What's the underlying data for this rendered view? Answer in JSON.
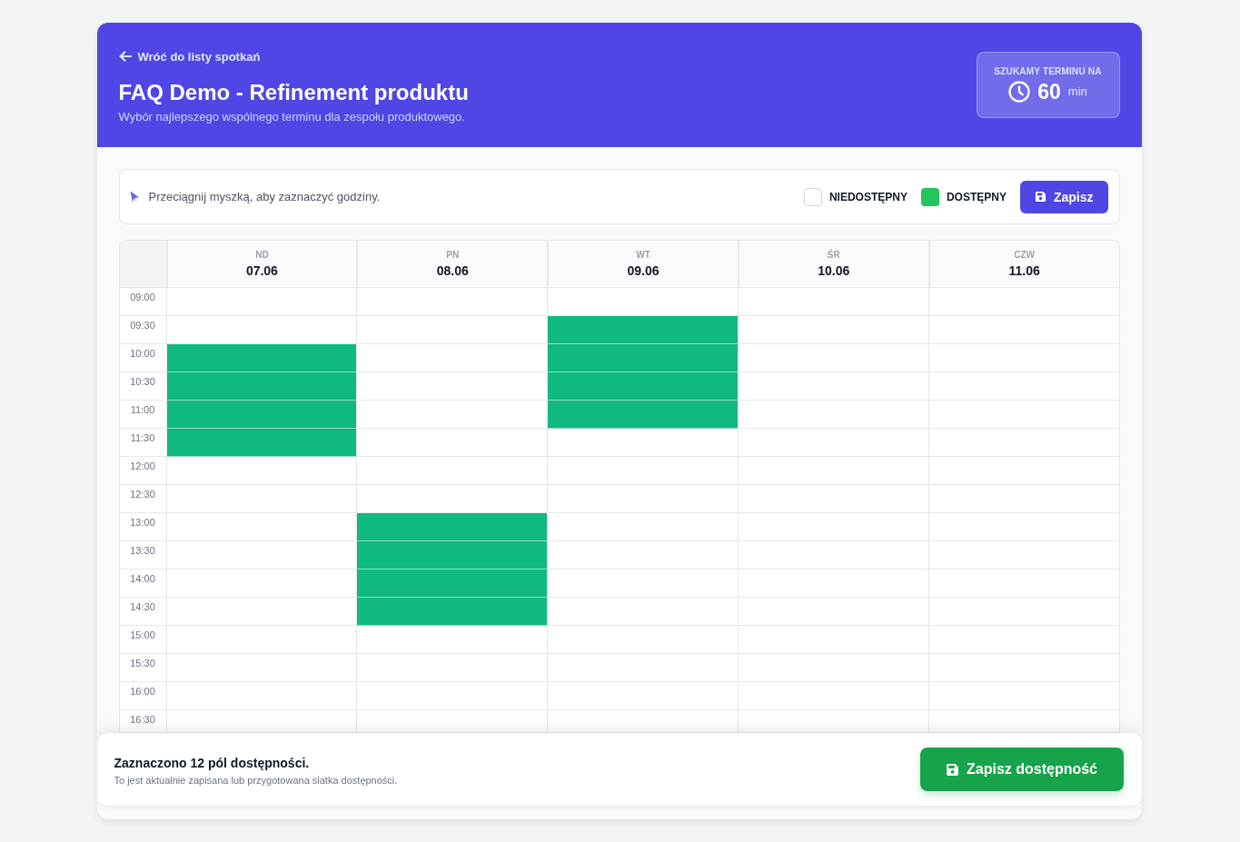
{
  "header": {
    "back_link": "Wróć do listy spotkań",
    "title": "FAQ Demo - Refinement produktu",
    "subtitle": "Wybór najlepszego wspólnego terminu dla zespołu produktowego.",
    "duration": {
      "label": "SZUKAMY TERMINU NA",
      "value": "60",
      "unit": "min"
    }
  },
  "toolbar": {
    "hint": "Przeciągnij myszką, aby zaznaczyć godziny.",
    "legend": [
      {
        "label": "NIEDOSTĘPNY",
        "color": "#ffffff"
      },
      {
        "label": "DOSTĘPNY",
        "color": "#22c55e"
      }
    ],
    "save_button": "Zapisz"
  },
  "grid": {
    "days": [
      {
        "weekday": "ND",
        "date": "07.06"
      },
      {
        "weekday": "PN",
        "date": "08.06"
      },
      {
        "weekday": "WT",
        "date": "09.06"
      },
      {
        "weekday": "ŚR",
        "date": "10.06"
      },
      {
        "weekday": "CZW",
        "date": "11.06"
      }
    ],
    "rows": [
      {
        "time": "09:00",
        "cells": [
          {
            "available": false
          },
          {
            "available": false
          },
          {
            "available": false
          },
          {
            "available": false
          },
          {
            "available": false
          }
        ]
      },
      {
        "time": "09:30",
        "cells": [
          {
            "available": false
          },
          {
            "available": false
          },
          {
            "available": true
          },
          {
            "available": false
          },
          {
            "available": false
          }
        ]
      },
      {
        "time": "10:00",
        "cells": [
          {
            "available": true
          },
          {
            "available": false
          },
          {
            "available": true
          },
          {
            "available": false
          },
          {
            "available": false
          }
        ]
      },
      {
        "time": "10:30",
        "cells": [
          {
            "available": true
          },
          {
            "available": false
          },
          {
            "available": true
          },
          {
            "available": false
          },
          {
            "available": false
          }
        ]
      },
      {
        "time": "11:00",
        "cells": [
          {
            "available": true
          },
          {
            "available": false
          },
          {
            "available": true
          },
          {
            "available": false
          },
          {
            "available": false
          }
        ]
      },
      {
        "time": "11:30",
        "cells": [
          {
            "available": true
          },
          {
            "available": false
          },
          {
            "available": false
          },
          {
            "available": false
          },
          {
            "available": false
          }
        ]
      },
      {
        "time": "12:00",
        "cells": [
          {
            "available": false
          },
          {
            "available": false
          },
          {
            "available": false
          },
          {
            "available": false
          },
          {
            "available": false
          }
        ]
      },
      {
        "time": "12:30",
        "cells": [
          {
            "available": false
          },
          {
            "available": false
          },
          {
            "available": false
          },
          {
            "available": false
          },
          {
            "available": false
          }
        ]
      },
      {
        "time": "13:00",
        "cells": [
          {
            "available": false
          },
          {
            "available": true
          },
          {
            "available": false
          },
          {
            "available": false
          },
          {
            "available": false
          }
        ]
      },
      {
        "time": "13:30",
        "cells": [
          {
            "available": false
          },
          {
            "available": true
          },
          {
            "available": false
          },
          {
            "available": false
          },
          {
            "available": false
          }
        ]
      },
      {
        "time": "14:00",
        "cells": [
          {
            "available": false
          },
          {
            "available": true
          },
          {
            "available": false
          },
          {
            "available": false
          },
          {
            "available": false
          }
        ]
      },
      {
        "time": "14:30",
        "cells": [
          {
            "available": false
          },
          {
            "available": true
          },
          {
            "available": false
          },
          {
            "available": false
          },
          {
            "available": false
          }
        ]
      },
      {
        "time": "15:00",
        "cells": [
          {
            "available": false
          },
          {
            "available": false
          },
          {
            "available": false
          },
          {
            "available": false
          },
          {
            "available": false
          }
        ]
      },
      {
        "time": "15:30",
        "cells": [
          {
            "available": false
          },
          {
            "available": false
          },
          {
            "available": false
          },
          {
            "available": false
          },
          {
            "available": false
          }
        ]
      },
      {
        "time": "16:00",
        "cells": [
          {
            "available": false
          },
          {
            "available": false
          },
          {
            "available": false
          },
          {
            "available": false
          },
          {
            "available": false
          }
        ]
      },
      {
        "time": "16:30",
        "cells": [
          {
            "available": false
          },
          {
            "available": false
          },
          {
            "available": false
          },
          {
            "available": false
          },
          {
            "available": false
          }
        ]
      }
    ]
  },
  "footer": {
    "summary": "Zaznaczono 12 pól dostępności.",
    "note": "To jest aktualnie zapisana lub przygotowana siatka dostępności.",
    "save_button": "Zapisz dostępność"
  }
}
